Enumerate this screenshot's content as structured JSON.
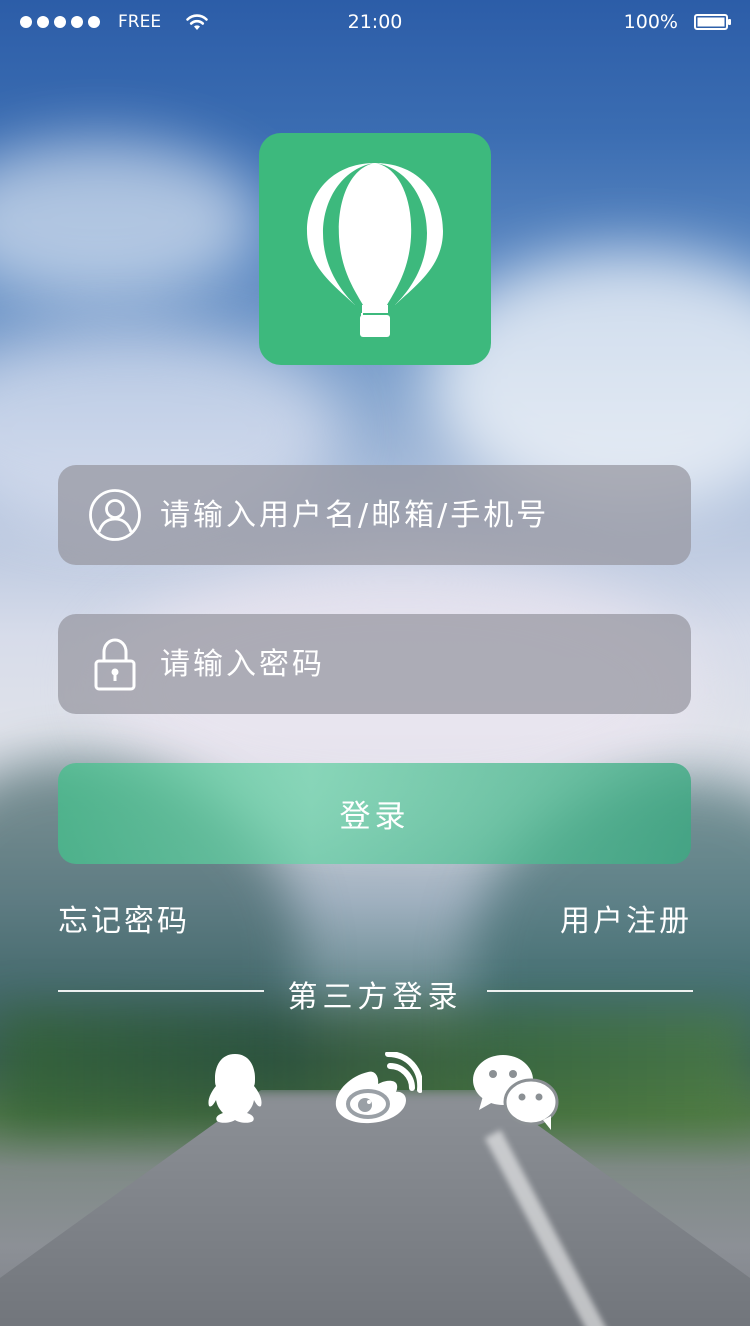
{
  "status_bar": {
    "carrier": "FREE",
    "time": "21:00",
    "battery": "100%"
  },
  "logo": {
    "icon": "hot-air-balloon-icon",
    "color": "#3db97d"
  },
  "form": {
    "username_placeholder": "请输入用户名/邮箱/手机号",
    "password_placeholder": "请输入密码",
    "login_label": "登录"
  },
  "links": {
    "forgot_password": "忘记密码",
    "register": "用户注册"
  },
  "third_party": {
    "title": "第三方登录",
    "providers": [
      "qq-icon",
      "weibo-icon",
      "wechat-icon"
    ]
  }
}
